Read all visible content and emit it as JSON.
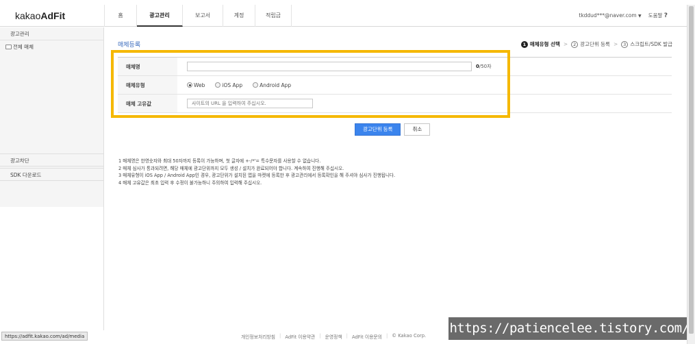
{
  "logo": {
    "brand": "kakao",
    "product": "AdFit"
  },
  "nav": {
    "tabs": [
      {
        "label": "홈"
      },
      {
        "label": "광고관리"
      },
      {
        "label": "보고서"
      },
      {
        "label": "계정"
      },
      {
        "label": "적립금"
      }
    ],
    "active_index": 1
  },
  "user": {
    "email": "tkddud***@naver.com",
    "help": "도움말",
    "help_mark": "?"
  },
  "sidebar": {
    "header": "광고관리",
    "tree_item": "전체 매체",
    "section_block": "광고차단",
    "section_sdk": "SDK 다운로드"
  },
  "page": {
    "title": "매체등록"
  },
  "steps": [
    {
      "num": "1",
      "label": "매체유형 선택"
    },
    {
      "num": "2",
      "label": "광고단위 등록"
    },
    {
      "num": "3",
      "label": "스크립트/SDK 발급"
    }
  ],
  "form": {
    "name_label": "매체명",
    "name_counter_current": "0",
    "name_counter_max": "/50자",
    "type_label": "매체유형",
    "type_options": [
      "Web",
      "iOS App",
      "Android App"
    ],
    "type_selected": "Web",
    "id_label": "매체 고유값",
    "id_placeholder": "사이트의 URL 을 입력하여 주십시오."
  },
  "buttons": {
    "submit": "광고단위 등록",
    "cancel": "취소"
  },
  "notes": [
    "1  매체명은 한영숫자와 최대 50자까지 등록이 가능하며, 첫 글자에 +-/*'= 특수문자를 사용할 수 없습니다.",
    "2  매체 심사가 통과되려면, 해당 매체에 광고단위까지 모두 생성 / 설치가 완료되어야 합니다. 계속하여 진행해 주십시오.",
    "3  매체유형이 iOS App / Android App인 경우, 광고단위가 설치된 앱을 마켓에 등록한 후 광고관리에서 등록확인을 해 주셔야 심사가 진행됩니다.",
    "4  매체 고유값은 최초 입력 후 수정이 불가능하니 주의하여 입력해 주십시오."
  ],
  "footer": {
    "links": [
      "개인정보처리방침",
      "AdFit 이용약관",
      "운영정책",
      "AdFit 이용문의"
    ],
    "copyright": "© Kakao Corp."
  },
  "status_url": "https://adfit.kakao.com/ad/media",
  "watermark": "https://patiencelee.tistory.com/",
  "colors": {
    "accent": "#3b84ed",
    "highlight": "#f5b800",
    "title": "#3b6bbd"
  }
}
